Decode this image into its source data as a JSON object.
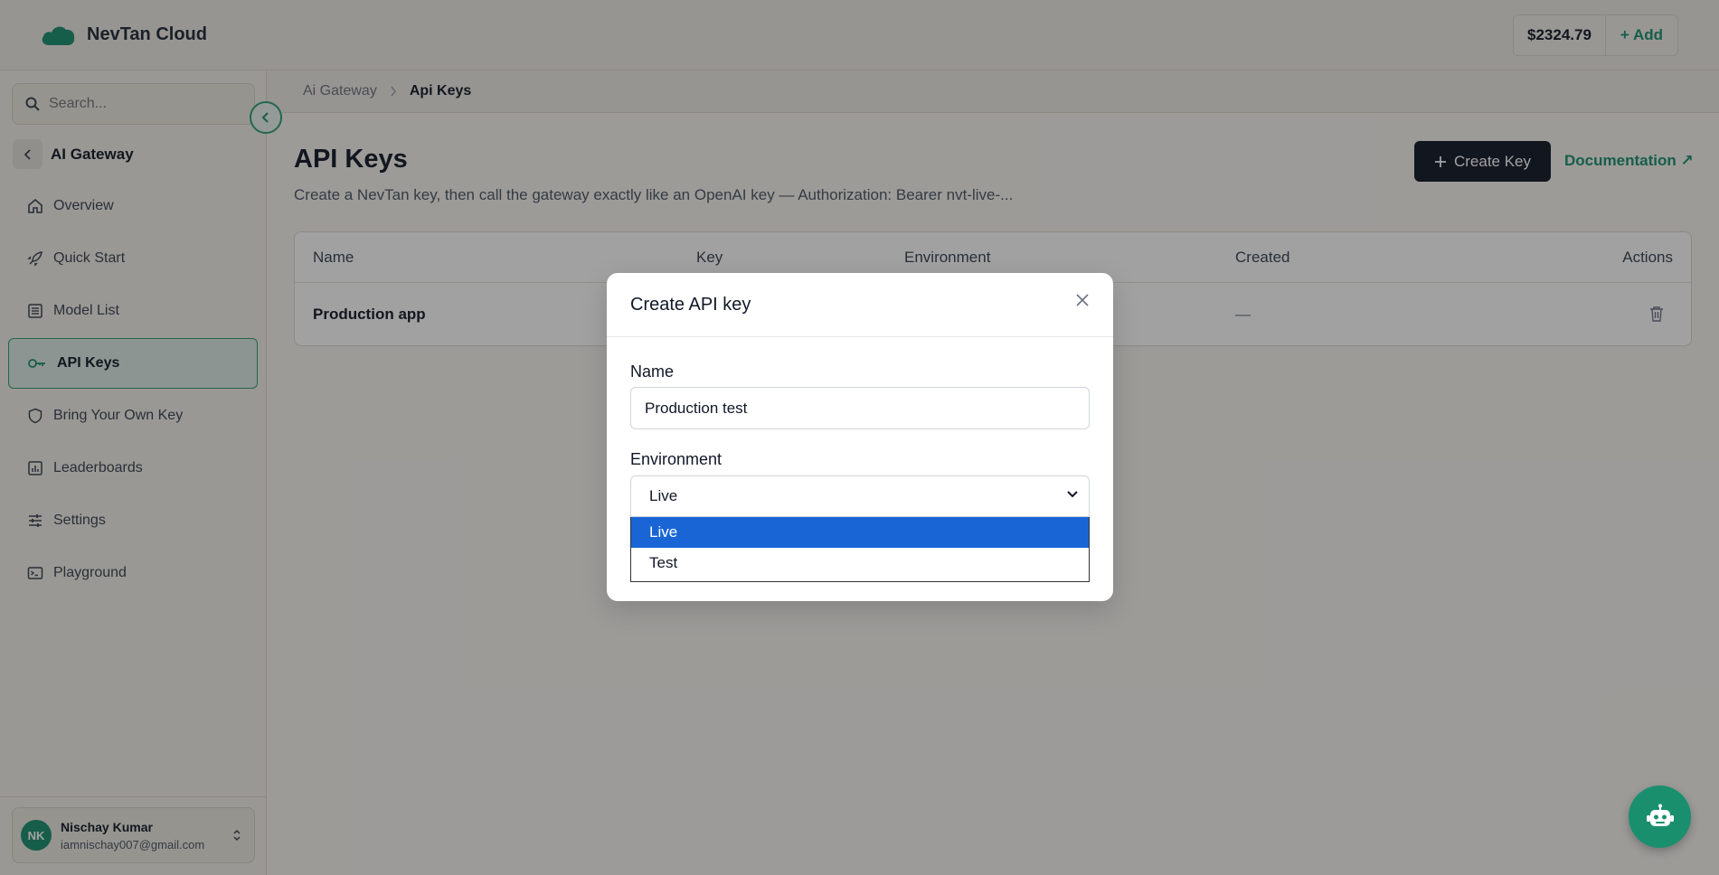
{
  "brand": {
    "name": "NevTan Cloud"
  },
  "wallet": {
    "balance": "$2324.79",
    "add_label": "+ Add"
  },
  "sidebar": {
    "search_placeholder": "Search...",
    "section_title": "AI Gateway",
    "items": [
      {
        "label": "Overview",
        "icon": "home-icon"
      },
      {
        "label": "Quick Start",
        "icon": "rocket-icon"
      },
      {
        "label": "Model List",
        "icon": "list-icon"
      },
      {
        "label": "API Keys",
        "icon": "key-icon",
        "active": true
      },
      {
        "label": "Bring Your Own Key",
        "icon": "shield-icon"
      },
      {
        "label": "Leaderboards",
        "icon": "bar-chart-icon"
      },
      {
        "label": "Settings",
        "icon": "sliders-icon"
      },
      {
        "label": "Playground",
        "icon": "terminal-icon"
      }
    ],
    "user": {
      "initials": "NK",
      "name": "Nischay Kumar",
      "email": "iamnischay007@gmail.com"
    }
  },
  "breadcrumb": {
    "parent": "Ai Gateway",
    "current": "Api Keys"
  },
  "page": {
    "title": "API Keys",
    "subtitle": "Create a NevTan key, then call the gateway exactly like an OpenAI key — Authorization: Bearer nvt-live-...",
    "create_label": "Create Key",
    "doc_label": "Documentation ↗"
  },
  "table": {
    "headers": [
      "Name",
      "Key",
      "Environment",
      "Created",
      "Actions"
    ],
    "rows": [
      {
        "name": "Production app",
        "created": "—"
      }
    ]
  },
  "modal": {
    "title": "Create API key",
    "name_label": "Name",
    "name_value": "Production test",
    "env_label": "Environment",
    "env_value": "Live",
    "options": [
      "Live",
      "Test"
    ]
  },
  "colors": {
    "accent": "#1a8f6e",
    "dark_button": "#111827",
    "selected_option": "#1a65d6"
  }
}
